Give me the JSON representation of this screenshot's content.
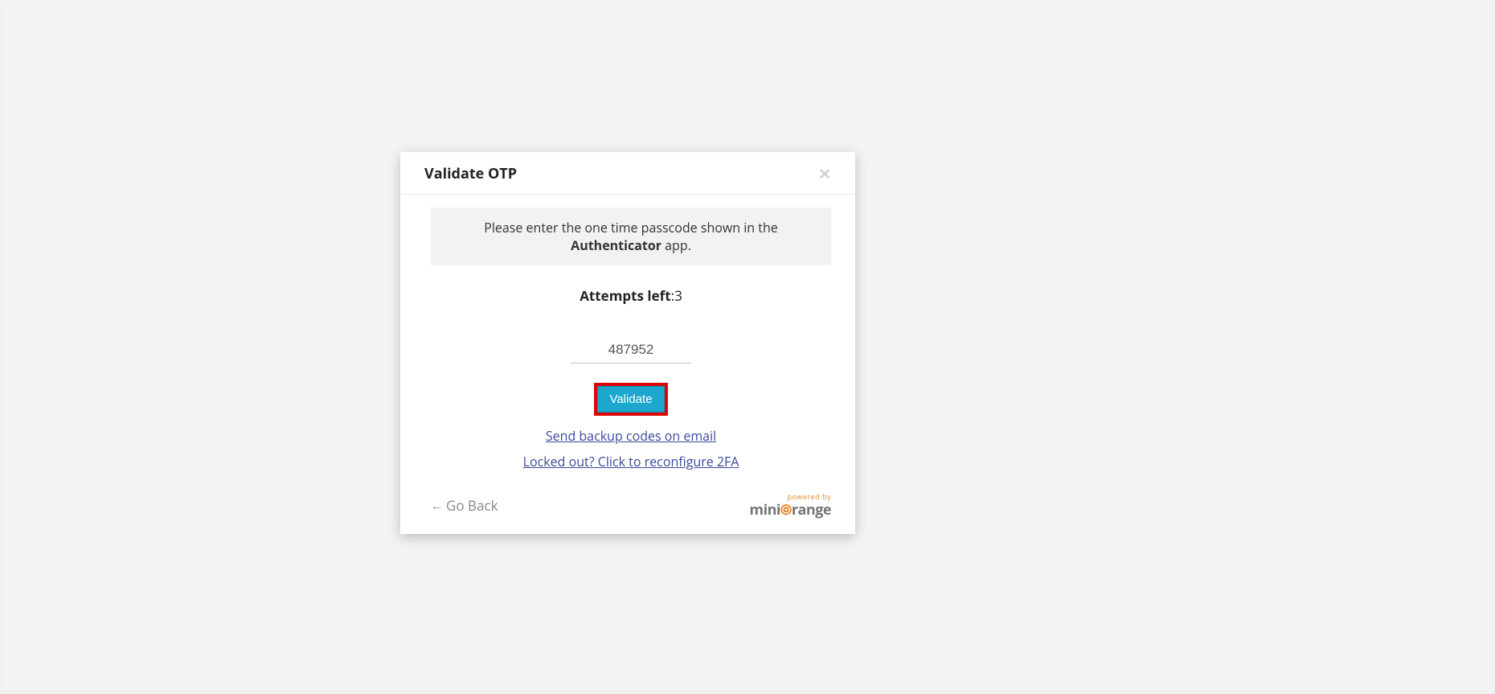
{
  "modal": {
    "title": "Validate OTP",
    "instruction_prefix": "Please enter the one time passcode shown in the ",
    "instruction_bold": "Authenticator",
    "instruction_suffix": " app.",
    "attempts_label": "Attempts left",
    "attempts_value": ":3",
    "otp_value": "487952",
    "validate_label": "Validate",
    "backup_link": "Send backup codes on email",
    "locked_link": "Locked out? Click to reconfigure 2FA",
    "go_back": "Go Back",
    "powered_by": "powered by",
    "brand_mini": "mini",
    "brand_range": "range"
  }
}
